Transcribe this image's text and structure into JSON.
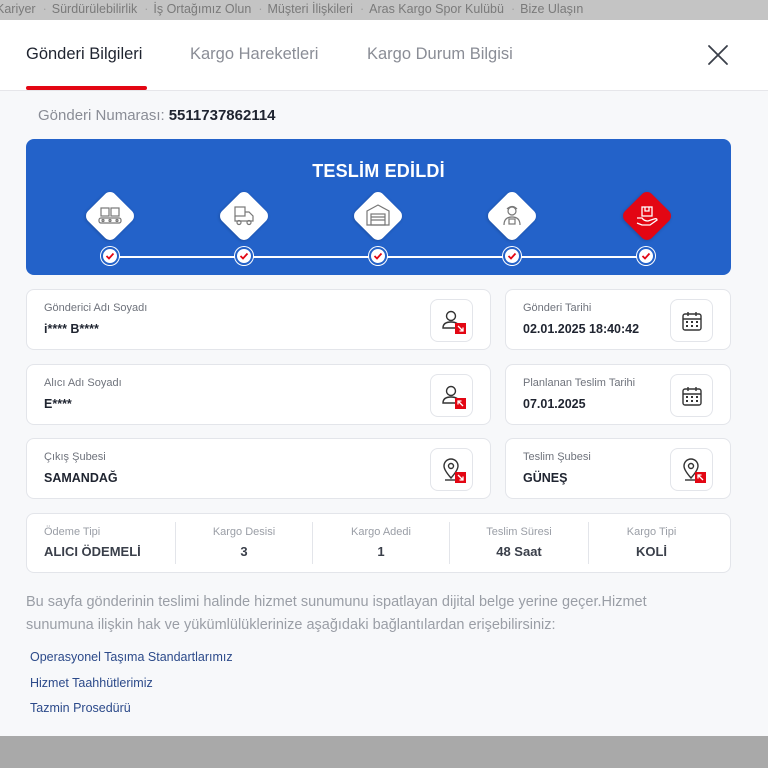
{
  "topnav": {
    "items": [
      "Kariyer",
      "Sürdürülebilirlik",
      "İş Ortağımız Olun",
      "Müşteri İlişkileri",
      "Aras Kargo Spor Kulübü",
      "Bize Ulaşın"
    ]
  },
  "tabs": [
    {
      "label": "Gönderi Bilgileri",
      "active": true
    },
    {
      "label": "Kargo Hareketleri",
      "active": false
    },
    {
      "label": "Kargo Durum Bilgisi",
      "active": false
    }
  ],
  "close_icon": "close-icon",
  "tracking": {
    "label": "Gönderi Numarası:",
    "number": "5511737862114"
  },
  "status": {
    "title": "TESLİM EDİLDİ",
    "steps": [
      {
        "icon": "packages-icon",
        "completed": true,
        "active": false
      },
      {
        "icon": "delivery-truck-icon",
        "completed": true,
        "active": false
      },
      {
        "icon": "warehouse-icon",
        "completed": true,
        "active": false
      },
      {
        "icon": "courier-icon",
        "completed": true,
        "active": false
      },
      {
        "icon": "hand-package-icon",
        "completed": true,
        "active": true
      }
    ]
  },
  "info": {
    "sender_name": {
      "label": "Gönderici Adı Soyadı",
      "value": "i**** B****",
      "icon": "person-outgoing-icon"
    },
    "sent_date": {
      "label": "Gönderi Tarihi",
      "value": "02.01.2025 18:40:42",
      "icon": "calendar-icon"
    },
    "receiver_name": {
      "label": "Alıcı Adı Soyadı",
      "value": "E****",
      "icon": "person-incoming-icon"
    },
    "planned_delivery": {
      "label": "Planlanan Teslim Tarihi",
      "value": "07.01.2025",
      "icon": "calendar-icon"
    },
    "origin_branch": {
      "label": "Çıkış Şubesi",
      "value": "SAMANDAĞ",
      "icon": "location-outgoing-icon"
    },
    "delivery_branch": {
      "label": "Teslim Şubesi",
      "value": "GÜNEŞ",
      "icon": "location-incoming-icon"
    }
  },
  "summary": [
    {
      "label": "Ödeme Tipi",
      "value": "ALICI ÖDEMELİ"
    },
    {
      "label": "Kargo Desisi",
      "value": "3"
    },
    {
      "label": "Kargo Adedi",
      "value": "1"
    },
    {
      "label": "Teslim Süresi",
      "value": "48 Saat"
    },
    {
      "label": "Kargo Tipi",
      "value": "KOLİ"
    }
  ],
  "disclaimer": "Bu sayfa gönderinin teslimi halinde hizmet sunumunu ispatlayan dijital belge yerine geçer.Hizmet sunumuna ilişkin hak ve yükümlülüklerinize aşağıdaki bağlantılardan erişebilirsiniz:",
  "links": [
    "Operasyonel Taşıma Standartlarımız",
    "Hizmet Taahhütlerimiz",
    "Tazmin Prosedürü"
  ],
  "colors": {
    "brand_red": "#e30613",
    "status_blue": "#2362c9",
    "link_blue": "#2c4a8a"
  }
}
